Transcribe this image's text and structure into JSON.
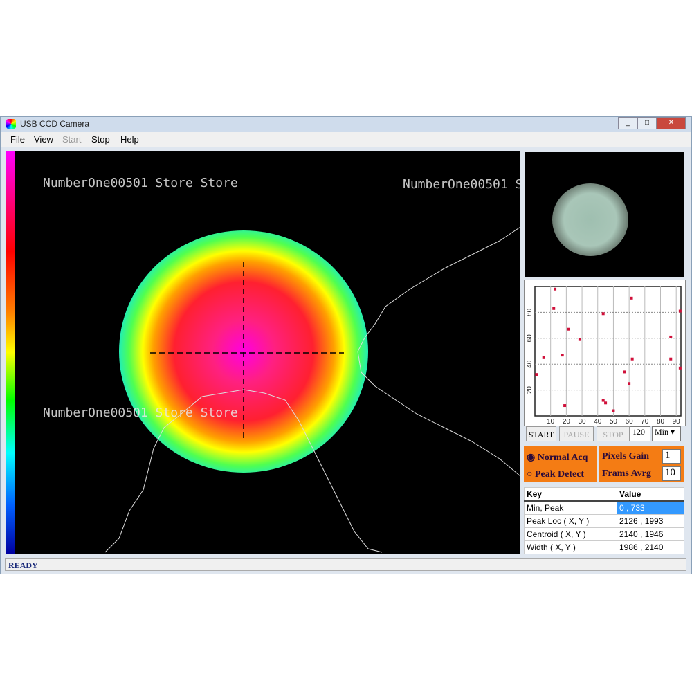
{
  "window": {
    "title": "USB CCD Camera"
  },
  "menu": [
    "File",
    "View",
    "Start",
    "Stop",
    "Help"
  ],
  "watermark": "NumberOne00501 Store Store",
  "controls": {
    "start": "START",
    "pause": "PAUSE",
    "stop": "STOP",
    "interval": "120",
    "unit": "Min"
  },
  "acq": {
    "normal": "Normal Acq",
    "peak": "Peak Detect",
    "gain_label": "Pixels Gain",
    "gain": "1",
    "avg_label": "Frams Avrg",
    "avg": "10",
    "selected": "normal"
  },
  "table": {
    "headers": [
      "Key",
      "Value"
    ],
    "rows": [
      [
        "Min, Peak",
        "0 , 733"
      ],
      [
        "Peak Loc ( X, Y )",
        "2126 , 1993"
      ],
      [
        "Centroid ( X, Y )",
        "2140 , 1946"
      ],
      [
        "Width ( X, Y )",
        "1986 , 2140"
      ]
    ]
  },
  "status": "READY",
  "chart_data": {
    "type": "scatter",
    "x_ticks": [
      10,
      20,
      30,
      40,
      50,
      60,
      70,
      80,
      90
    ],
    "y_ticks": [
      20,
      40,
      60,
      80
    ],
    "xlim": [
      0,
      93
    ],
    "ylim": [
      0,
      100
    ],
    "grid": true,
    "color": "#d0103a",
    "points": [
      [
        1,
        32
      ],
      [
        5.6,
        45
      ],
      [
        12.8,
        98
      ],
      [
        12,
        83
      ],
      [
        19,
        8
      ],
      [
        17.5,
        47
      ],
      [
        21.5,
        67
      ],
      [
        28.6,
        59
      ],
      [
        43.5,
        79
      ],
      [
        43.5,
        12
      ],
      [
        45,
        10
      ],
      [
        50,
        4
      ],
      [
        57,
        34
      ],
      [
        60,
        25
      ],
      [
        61.5,
        91
      ],
      [
        62,
        44
      ],
      [
        86.5,
        61
      ],
      [
        86.5,
        44
      ],
      [
        92.5,
        81
      ],
      [
        92.5,
        37
      ]
    ]
  }
}
